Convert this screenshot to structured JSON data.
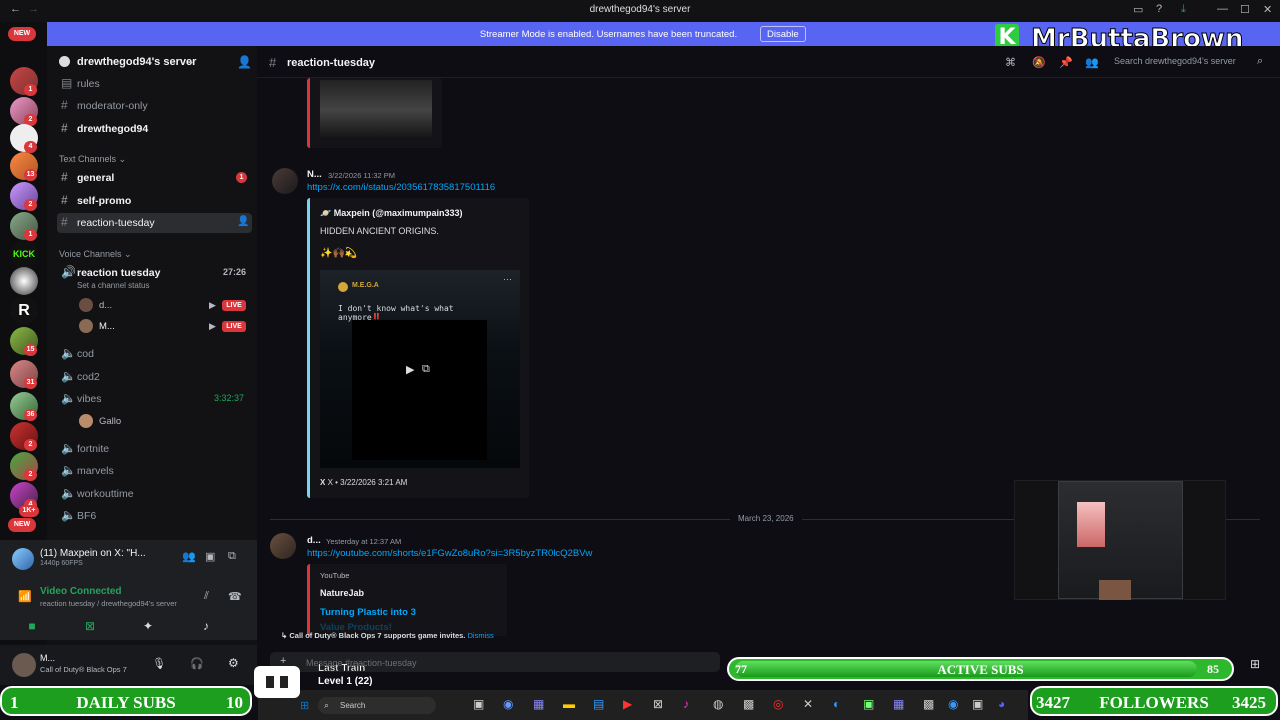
{
  "window": {
    "title": "drewthegod94's server"
  },
  "banner": {
    "message": "Streamer Mode is enabled. Usernames have been truncated.",
    "disable": "Disable"
  },
  "rail": {
    "new_top": "NEW",
    "new_bottom": "NEW",
    "badges": [
      "1",
      "2",
      "4",
      "13",
      "2",
      "1",
      "15",
      "31",
      "36",
      "2",
      "2",
      "4",
      "1K+"
    ]
  },
  "sidebar": {
    "server_name": "drewthegod94's server",
    "channels_top": [
      "rules",
      "moderator-only",
      "drewthegod94"
    ],
    "text_category": "Text Channels",
    "text_channels": [
      "general",
      "self-promo",
      "reaction-tuesday"
    ],
    "general_badge": "1",
    "voice_category": "Voice Channels",
    "voice_active": {
      "name": "reaction tuesday",
      "timer": "27:26",
      "status": "Set a channel status"
    },
    "voice_users": [
      {
        "name": "d...",
        "live": "LIVE"
      },
      {
        "name": "M...",
        "live": "LIVE"
      }
    ],
    "voice_channels": [
      "cod",
      "cod2",
      "vibes",
      "fortnite",
      "marvels",
      "workouttime",
      "BF6"
    ],
    "vibes_timer": "3:32:37",
    "vibes_user": "Gallo"
  },
  "activity": {
    "title": "(11) Maxpein on X: \"H...",
    "sub": "1440p 60FPS"
  },
  "voice_conn": {
    "status": "Video Connected",
    "channel": "reaction tuesday / drewthegod94's server"
  },
  "user": {
    "name": "M...",
    "game": "Call of Duty® Black Ops 7"
  },
  "chat": {
    "channel": "reaction-tuesday",
    "search": "Search drewthegod94's server",
    "msg1": {
      "author": "N...",
      "time": "3/22/2026 11:32 PM",
      "link": "https://x.com/i/status/2035617835817501116",
      "embed_author": "Maxpein (@maximumpain333)",
      "embed_text": "HIDDEN ANCIENT ORIGINS.",
      "embed_emoji": "✨🙌🏾💫",
      "video_account": "M.E.G.A",
      "video_caption": "I don't know what's what anymore‼️",
      "footer": "X • 3/22/2026 3:21 AM"
    },
    "divider": "March 23, 2026",
    "msg2": {
      "author": "d...",
      "time": "Yesterday at 12:37 AM",
      "link": "https://youtube.com/shorts/e1FGwZo8uRo?si=3R5byzTR0lcQ2BVw",
      "provider": "YouTube",
      "channel": "NatureJab",
      "title": "Turning Plastic into 3",
      "title2": "Value Products!"
    },
    "invite": {
      "text": "Call of Duty® Black Ops 7 supports game invites.",
      "dismiss": "Dismiss"
    },
    "input_placeholder": "Message #reaction-tuesday"
  },
  "overlay": {
    "brand": "MrButtaBrown",
    "active_subs": {
      "left": "77",
      "label": "ACTIVE SUBS",
      "right": "85"
    },
    "daily_subs": {
      "left": "1",
      "label": "DAILY SUBS",
      "right": "10"
    },
    "followers": {
      "left": "3427",
      "label": "FOLLOWERS",
      "right": "3425"
    },
    "song": {
      "title": "Last Train",
      "level": "Level 1  (22)"
    }
  },
  "taskbar": {
    "search": "Search"
  }
}
